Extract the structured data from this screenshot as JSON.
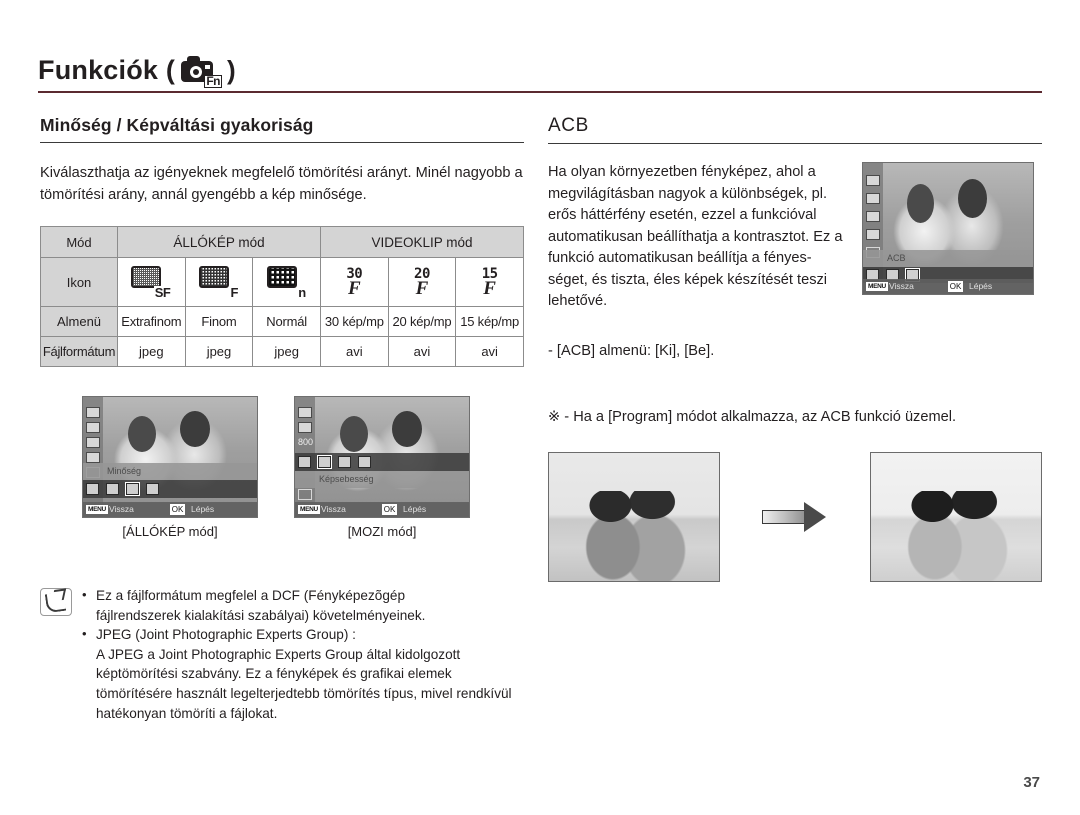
{
  "header": {
    "title": "Funkciók (",
    "title_close": ")",
    "icon_label": "Fn",
    "rule_color": "#5b2a30"
  },
  "left": {
    "heading": "Minőség / Képváltási gyakoriság",
    "intro": "Kiválaszthatja az igényeknek megfelelő tömörítési arányt. Minél nagyobb a tömörítési arány, annál gyengébb a kép minősége.",
    "table": {
      "row_labels": [
        "Mód",
        "Ikon",
        "Almenü",
        "Fájlformátum"
      ],
      "group_headers": [
        "ÁLLÓKÉP mód",
        "VIDEOKLIP mód"
      ],
      "icons": [
        "SF",
        "F",
        "n",
        "30",
        "20",
        "15"
      ],
      "submenu": [
        "Extrafinom",
        "Finom",
        "Normál",
        "30 kép/mp",
        "20 kép/mp",
        "15 kép/mp"
      ],
      "fileformat": [
        "jpeg",
        "jpeg",
        "jpeg",
        "avi",
        "avi",
        "avi"
      ]
    },
    "lcd_still": {
      "menu_label": "Minőség",
      "back_key": "MENU",
      "back_label": "Vissza",
      "ok_key": "OK",
      "step_label": "Lépés",
      "caption": "[ÁLLÓKÉP mód]"
    },
    "lcd_movie": {
      "iso_label": "800",
      "menu_label": "Képsebesség",
      "back_key": "MENU",
      "back_label": "Vissza",
      "ok_key": "OK",
      "step_label": "Lépés",
      "caption": "[MOZI mód]"
    },
    "note": {
      "item1_line1": "Ez a fájlformátum megfelel a DCF (Fényképezõgép",
      "item1_line2": "fájlrendszerek kialakítási szabályai) követelményeinek.",
      "item2_line1": "JPEG (Joint Photographic Experts Group) :",
      "item2_body": "A JPEG a Joint Photographic Experts Group által kidolgozott képtömörítési szabvány. Ez a fényképek és grafikai elemek tömörítésére használt legelterjedtebb tömörítés típus, mivel rendkívül hatékonyan tömöríti a fájlokat."
    }
  },
  "right": {
    "heading": "ACB",
    "intro": "Ha olyan környezetben fényképez, ahol a megvilágításban nagyok a különbségek, pl. erős háttérfény esetén, ezzel a funkcióval automatikusan beállíthatja a kontrasztot. Ez a funkció automatikusan beállítja a fényes-séget, és tiszta, éles képek készítését teszi lehetővé.",
    "submenu_note": "- [ACB] almenü: [Ki], [Be].",
    "program_note": "※ - Ha a [Program] módot alkalmazza, az ACB funkció üzemel.",
    "lcd_acb": {
      "menu_label": "ACB",
      "back_key": "MENU",
      "back_label": "Vissza",
      "ok_key": "OK",
      "step_label": "Lépés"
    }
  },
  "footer": {
    "page_number": "37"
  }
}
